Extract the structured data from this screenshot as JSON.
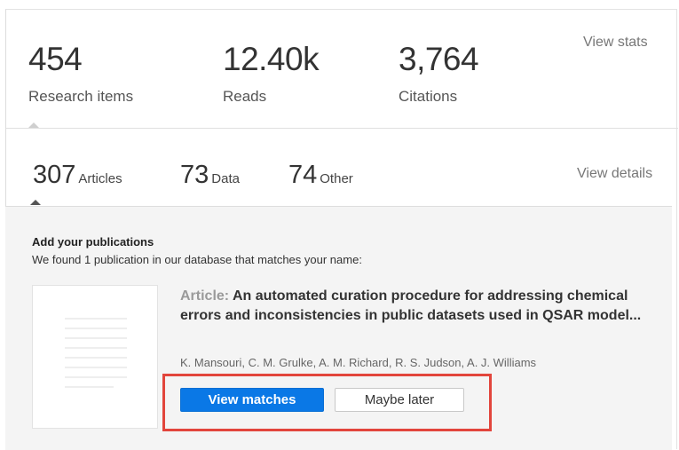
{
  "stats": [
    {
      "value": "454",
      "label": "Research items"
    },
    {
      "value": "12.40k",
      "label": "Reads"
    },
    {
      "value": "3,764",
      "label": "Citations"
    }
  ],
  "view_stats_label": "View stats",
  "counts": [
    {
      "value": "307",
      "label": "Articles"
    },
    {
      "value": "73",
      "label": "Data"
    },
    {
      "value": "74",
      "label": "Other"
    }
  ],
  "view_details_label": "View details",
  "prompt": {
    "title": "Add your publications",
    "subtitle": "We found 1 publication in our database that matches your name:",
    "article_type": "Article:",
    "article_title": "An automated curation procedure for addressing chemical errors and inconsistencies in public datasets used in QSAR model...",
    "authors": [
      "K. Mansouri",
      "C. M. Grulke",
      "A. M. Richard",
      "R. S. Judson",
      "A. J. Williams"
    ],
    "primary_button": "View matches",
    "secondary_button": "Maybe later"
  },
  "colors": {
    "primary": "#0a78e6",
    "highlight": "#e2453c"
  }
}
